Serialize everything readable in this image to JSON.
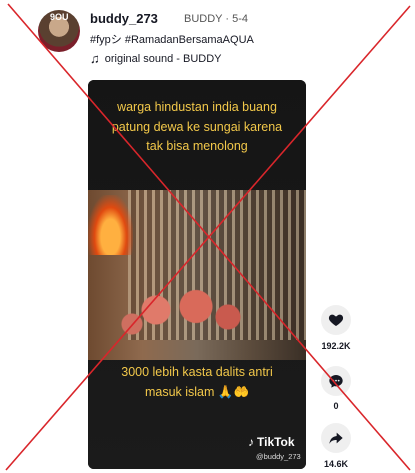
{
  "post": {
    "avatar_text": "9OU",
    "username": "buddy_273",
    "meta": "BUDDY · 5-4",
    "caption": "#fypシ #RamadanBersamaAQUA",
    "sound": "original sound - BUDDY"
  },
  "video": {
    "caption_top": "warga hindustan india buang patung dewa ke sungai karena tak bisa menolong",
    "caption_bottom": "3000 lebih kasta dalits antri masuk islam 🙏🤲",
    "watermark": "TikTok",
    "handle": "@buddy_273"
  },
  "actions": {
    "likes": "192.2K",
    "comments": "0",
    "shares": "14.6K"
  },
  "overlay": {
    "cross_color": "#d9262b"
  }
}
